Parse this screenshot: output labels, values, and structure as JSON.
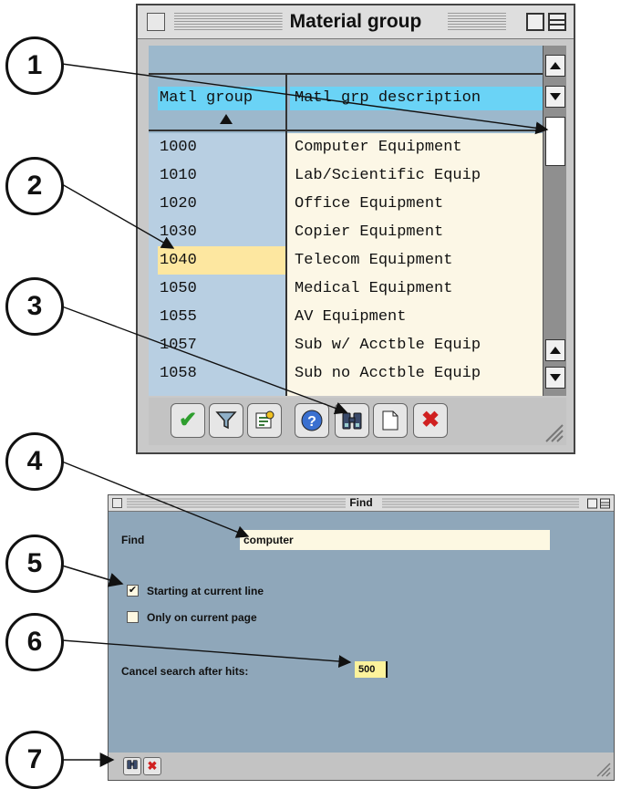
{
  "material_group_window": {
    "title": "Material group",
    "columns": [
      "Matl group",
      "Matl grp description"
    ],
    "rows": [
      {
        "code": "1000",
        "description": "Computer Equipment"
      },
      {
        "code": "1010",
        "description": "Lab/Scientific Equip"
      },
      {
        "code": "1020",
        "description": "Office Equipment"
      },
      {
        "code": "1030",
        "description": "Copier Equipment"
      },
      {
        "code": "1040",
        "description": "Telecom Equipment",
        "selected": true
      },
      {
        "code": "1050",
        "description": "Medical Equipment"
      },
      {
        "code": "1055",
        "description": "AV Equipment"
      },
      {
        "code": "1057",
        "description": "Sub w/ Acctble Equip"
      },
      {
        "code": "1058",
        "description": "Sub no Acctble Equip"
      }
    ],
    "toolbar_icons": [
      "checkmark-icon",
      "filter-icon",
      "new-entry-icon",
      "help-icon",
      "find-binoculars-icon",
      "page-icon",
      "cancel-x-icon"
    ]
  },
  "find_window": {
    "title": "Find",
    "find_label": "Find",
    "find_value": "computer",
    "starting_at_current_line": {
      "label": "Starting at current line",
      "checked": true
    },
    "only_on_current_page": {
      "label": "Only on current page",
      "checked": false
    },
    "cancel_label": "Cancel search after hits:",
    "cancel_value": "500",
    "toolbar_icons": [
      "find-binoculars-icon",
      "cancel-x-icon"
    ]
  },
  "callouts": [
    "1",
    "2",
    "3",
    "4",
    "5",
    "6",
    "7"
  ],
  "colors": {
    "header_cyan": "#6ad3f6",
    "code_column": "#b8cfe2",
    "description_column": "#fcf7e6",
    "selected_row": "#fde7a0",
    "find_background": "#8fa7ba"
  }
}
